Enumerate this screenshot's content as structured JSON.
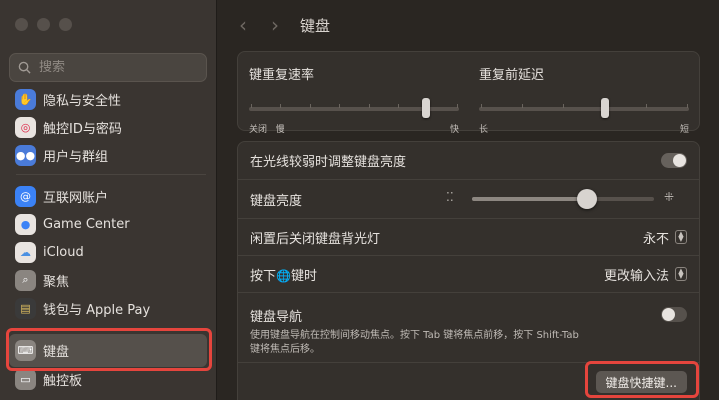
{
  "window": {
    "title": "键盘"
  },
  "search": {
    "placeholder": "搜索"
  },
  "sidebar": {
    "items": [
      {
        "label": "隐私与安全性",
        "icon": "hand-icon",
        "color": "#4a7bd9"
      },
      {
        "label": "触控ID与密码",
        "icon": "fingerprint-icon",
        "color": "#e9e4e0"
      },
      {
        "label": "用户与群组",
        "icon": "users-icon",
        "color": "#4a7bd9"
      },
      {
        "label": "互联网账户",
        "icon": "at-icon",
        "color": "#3b82f6"
      },
      {
        "label": "Game Center",
        "icon": "game-center-icon",
        "color": "#e9e4e0"
      },
      {
        "label": "iCloud",
        "icon": "cloud-icon",
        "color": "#e9e4e0"
      },
      {
        "label": "聚焦",
        "icon": "magnifier-icon",
        "color": "#8a8580"
      },
      {
        "label": "钱包与 Apple Pay",
        "icon": "wallet-icon",
        "color": "#3a3a3a"
      },
      {
        "label": "键盘",
        "icon": "keyboard-icon",
        "color": "#8a8580"
      },
      {
        "label": "触控板",
        "icon": "trackpad-icon",
        "color": "#8a8580"
      }
    ]
  },
  "repeat": {
    "key_repeat_title": "键重复速率",
    "key_repeat_left": "关闭",
    "key_repeat_left2": "慢",
    "key_repeat_right": "快",
    "key_repeat_value": 0.85,
    "delay_title": "重复前延迟",
    "delay_left": "长",
    "delay_right": "短",
    "delay_value": 0.6
  },
  "settings": {
    "auto_brightness_label": "在光线较弱时调整键盘亮度",
    "auto_brightness_on": true,
    "brightness_label": "键盘亮度",
    "brightness_value": 0.63,
    "backlight_off_label": "闲置后关闭键盘背光灯",
    "backlight_off_value": "永不",
    "globe_label_prefix": "按下",
    "globe_label_suffix": "键时",
    "globe_value": "更改输入法",
    "nav_label": "键盘导航",
    "nav_desc_1": "使用键盘导航在控制间移动焦点。按下 Tab 键将焦点前移，按下 Shift-Tab",
    "nav_desc_2": "键将焦点后移。",
    "nav_on": false,
    "shortcuts_button": "键盘快捷键..."
  },
  "colors": {
    "highlight": "#e5453d"
  }
}
